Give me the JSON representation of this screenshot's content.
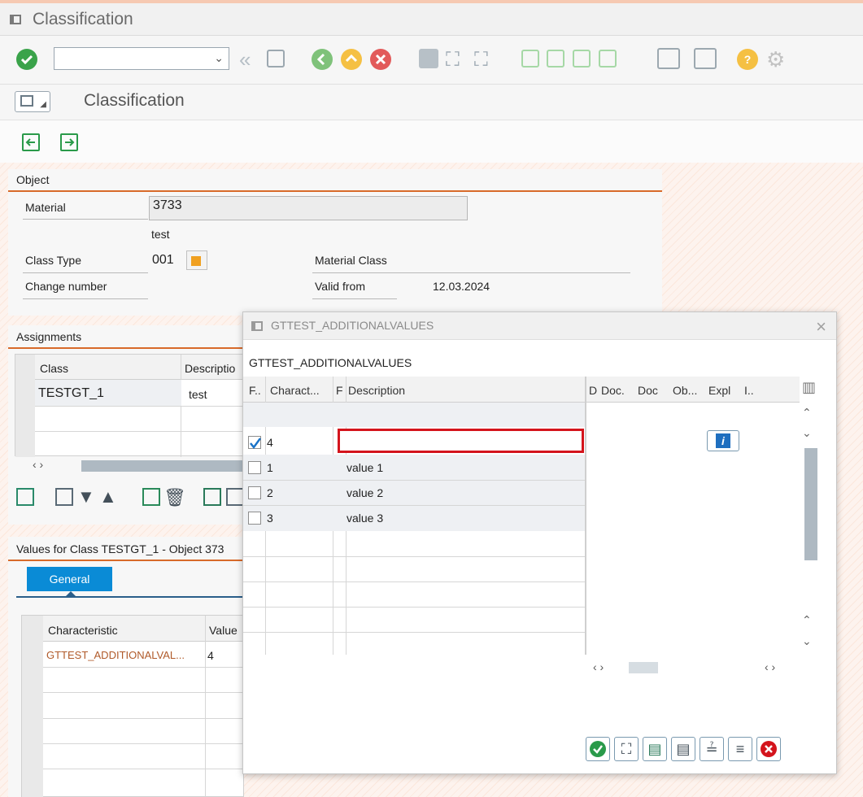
{
  "window": {
    "title": "Classification"
  },
  "page": {
    "title": "Classification"
  },
  "toolbar": {
    "command_value": ""
  },
  "object_panel": {
    "heading": "Object",
    "material_label": "Material",
    "material_value": "3733",
    "material_desc": "test",
    "class_type_label": "Class Type",
    "class_type_value": "001",
    "class_type_desc": "Material Class",
    "change_number_label": "Change number",
    "valid_from_label": "Valid from",
    "valid_from_value": "12.03.2024"
  },
  "assignments_panel": {
    "heading": "Assignments",
    "col_class": "Class",
    "col_description": "Descriptio",
    "rows": [
      {
        "class": "TESTGT_1",
        "description": "test"
      }
    ]
  },
  "values_panel": {
    "heading": "Values for Class TESTGT_1 - Object 373",
    "tab_general": "General",
    "col_characteristic": "Characteristic",
    "col_value": "Value",
    "rows": [
      {
        "characteristic": "GTTEST_ADDITIONALVAL...",
        "value": "4"
      }
    ]
  },
  "popup": {
    "title": "GTTEST_ADDITIONALVALUES",
    "subtitle": "GTTEST_ADDITIONALVALUES",
    "headers": {
      "f": "F..",
      "charact": "Charact...",
      "f2": "F",
      "description": "Description",
      "d": "D",
      "doc": "Doc.",
      "doc2": "Doc",
      "ob": "Ob...",
      "expl": "Expl",
      "i": "I.."
    },
    "rows": [
      {
        "checked": true,
        "value": "4",
        "description": ""
      },
      {
        "checked": false,
        "value": "1",
        "description": "value 1"
      },
      {
        "checked": false,
        "value": "2",
        "description": "value 2"
      },
      {
        "checked": false,
        "value": "3",
        "description": "value 3"
      }
    ]
  },
  "colors": {
    "accent_orange": "#d86a2a",
    "highlight_red": "#d4141c",
    "tab_blue": "#0a8bd6",
    "sap_green": "#2a9a4a"
  }
}
